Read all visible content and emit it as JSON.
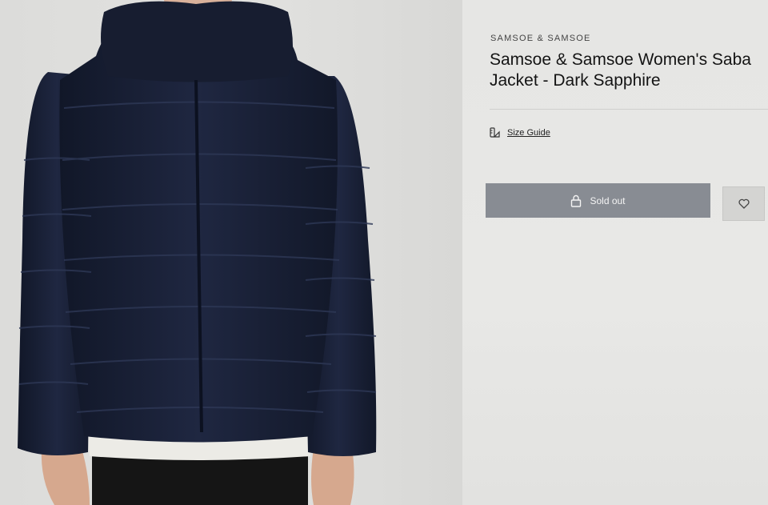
{
  "product": {
    "brand": "SAMSOE & SAMSOE",
    "title": "Samsoe & Samsoe Women's Saba Jacket - Dark Sapphire",
    "size_guide_label": "Size Guide",
    "sold_out_label": "Sold out"
  },
  "icons": {
    "size_guide": "ruler-icon",
    "sold_out": "lock-icon",
    "wishlist": "heart-icon"
  },
  "colors": {
    "jacket": "#1a2036",
    "button": "#888c93"
  }
}
